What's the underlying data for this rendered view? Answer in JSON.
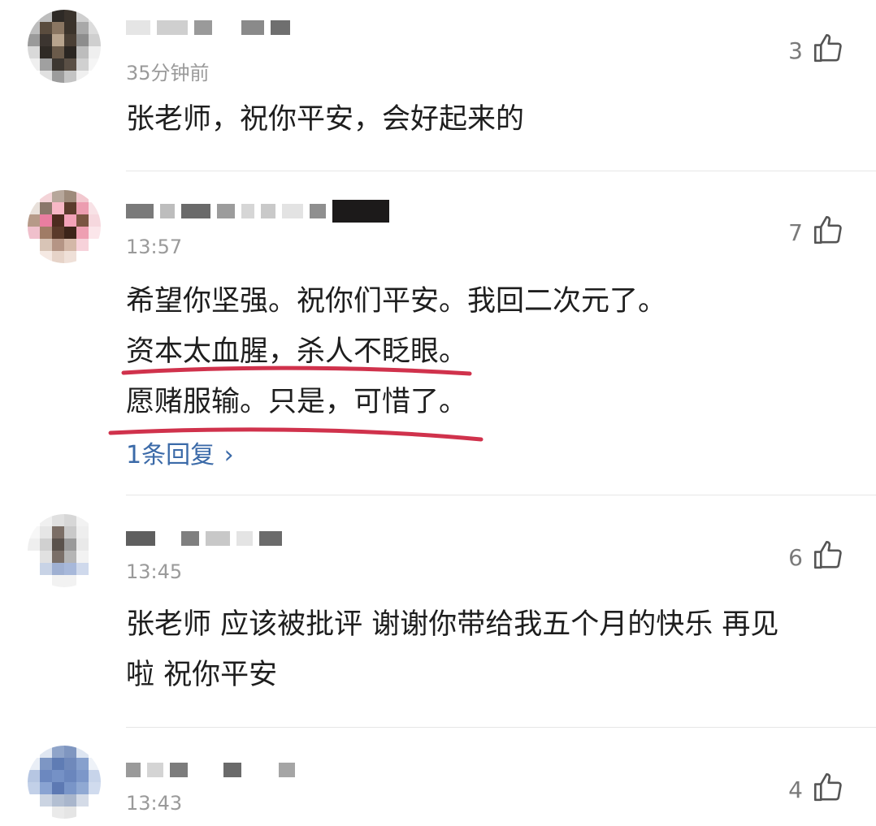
{
  "comments": [
    {
      "time": "35分钟前",
      "likes": "3",
      "lines": [
        "张老师，祝你平安，会好起来的"
      ]
    },
    {
      "time": "13:57",
      "likes": "7",
      "lines": [
        "希望你坚强。祝你们平安。我回二次元了。",
        "资本太血腥，杀人不眨眼。",
        "愿赌服输。只是，可惜了。"
      ],
      "reply_link": "1条回复"
    },
    {
      "time": "13:45",
      "likes": "6",
      "lines": [
        "张老师 应该被批评 谢谢你带给我五个月的快乐 再见",
        "啦 祝你平安"
      ]
    },
    {
      "time": "13:43",
      "likes": "4",
      "lines": []
    }
  ],
  "colors": {
    "annotation": "#d0324c",
    "link": "#3b6aa8",
    "meta": "#9a9a9a"
  },
  "icons": {
    "like": "thumbs-up-icon",
    "reply_arrow": "chevron-right-icon"
  }
}
